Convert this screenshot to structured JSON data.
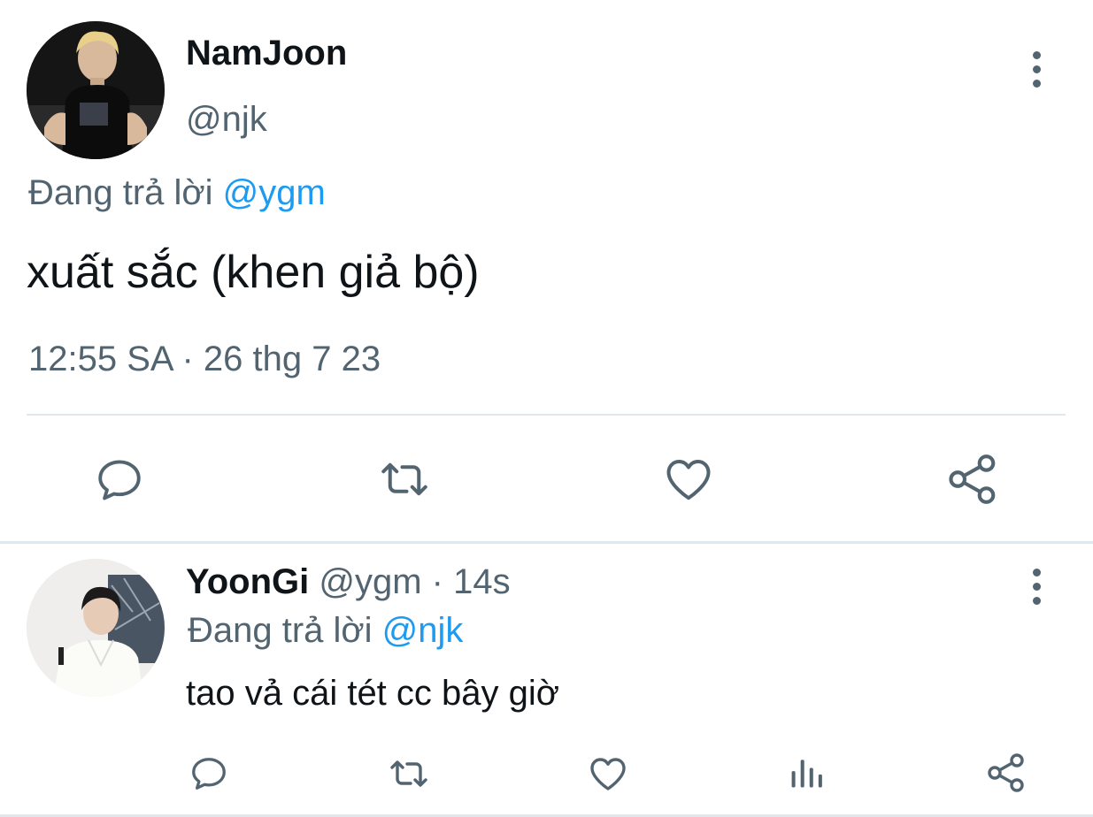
{
  "main_tweet": {
    "author_name": "NamJoon",
    "author_handle": "@njk",
    "replying_to_prefix": "Đang trả lời",
    "replying_to_handle": "@ygm",
    "text": "xuất sắc (khen giả bộ)",
    "timestamp": "12:55 SA · 26 thg 7 23",
    "actions": [
      "reply-icon",
      "retweet-icon",
      "like-icon",
      "share-icon"
    ]
  },
  "reply_tweet": {
    "author_name": "YoonGi",
    "author_handle": "@ygm",
    "separator": " · ",
    "time_ago": "14s",
    "replying_to_prefix": "Đang trả lời",
    "replying_to_handle": "@njk",
    "text": "tao vả cái tét cc bây giờ",
    "actions": [
      "reply-icon",
      "retweet-icon",
      "like-icon",
      "analytics-icon",
      "share-icon"
    ]
  },
  "colors": {
    "text": "#0f1419",
    "secondary": "#536471",
    "link": "#1d9bf0",
    "divider": "#e1e8ed"
  }
}
